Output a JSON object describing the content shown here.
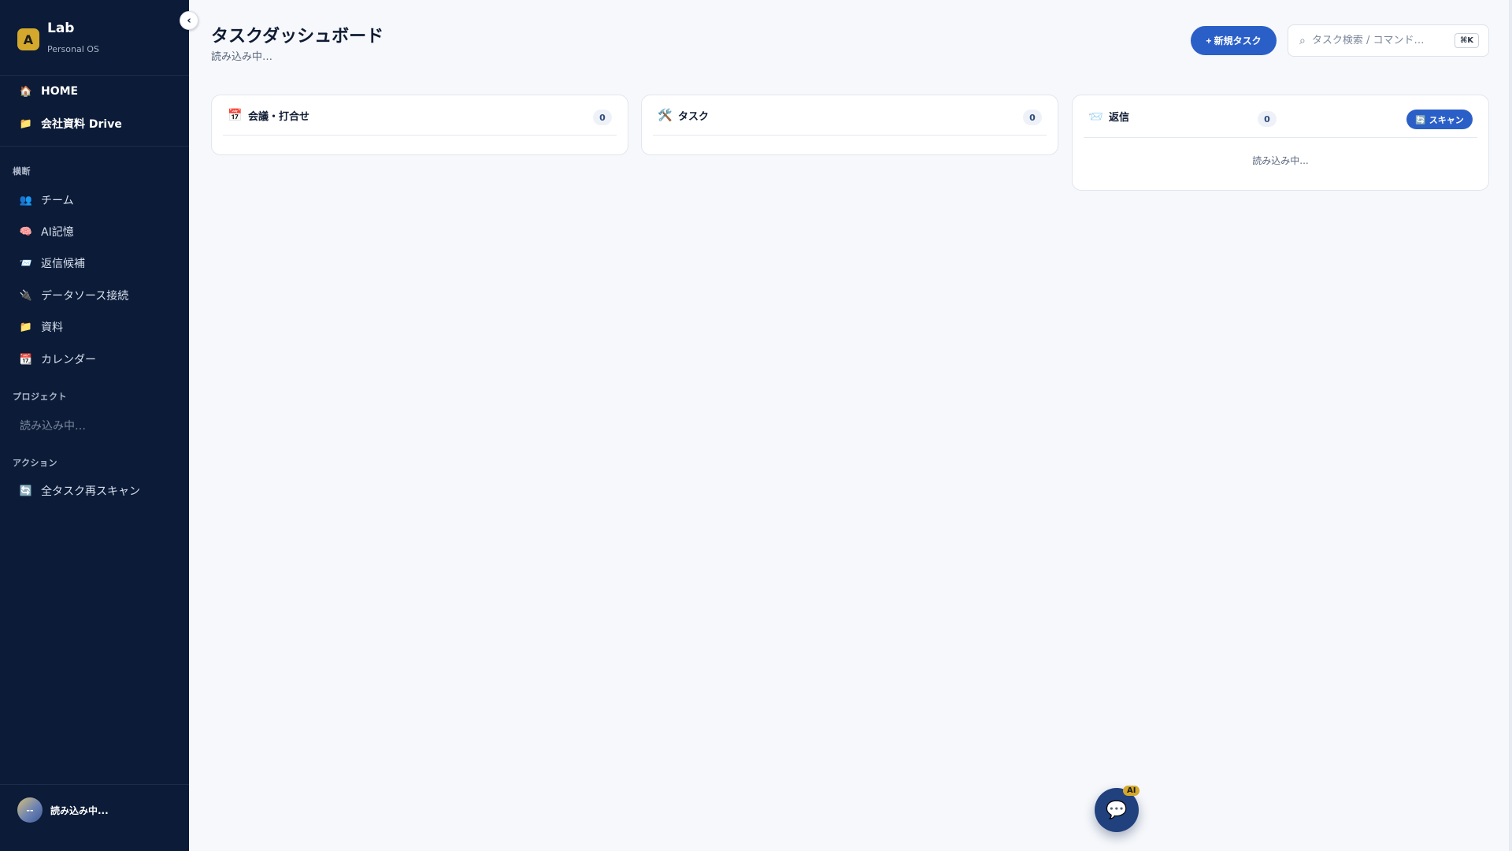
{
  "brand": {
    "logo_letter": "A",
    "name": "Lab",
    "subtitle": "Personal OS"
  },
  "sidebar": {
    "collapse_icon": "‹",
    "primary": [
      {
        "icon": "🏠",
        "label": "HOME"
      },
      {
        "icon": "📁",
        "label": "会社資料 Drive"
      }
    ],
    "section_cross": "横断",
    "cross_items": [
      {
        "icon": "👥",
        "label": "チーム"
      },
      {
        "icon": "🧠",
        "label": "AI記憶"
      },
      {
        "icon": "📨",
        "label": "返信候補"
      },
      {
        "icon": "🔌",
        "label": "データソース接続"
      },
      {
        "icon": "📁",
        "label": "資料"
      },
      {
        "icon": "📆",
        "label": "カレンダー"
      }
    ],
    "section_projects": "プロジェクト",
    "projects_loading": "読み込み中…",
    "section_actions": "アクション",
    "action_items": [
      {
        "icon": "🔄",
        "label": "全タスク再スキャン"
      }
    ],
    "user": {
      "avatar": "--",
      "name": "読み込み中..."
    }
  },
  "header": {
    "title": "タスクダッシュボード",
    "subtitle": "読み込み中…",
    "new_task_label": "+ 新規タスク",
    "search_placeholder": "タスク検索 / コマンド…",
    "search_value": "",
    "shortcut": "⌘K"
  },
  "cards": {
    "meetings": {
      "icon": "📅",
      "title": "会議・打合せ",
      "count": "0"
    },
    "tasks": {
      "icon": "🛠️",
      "title": "タスク",
      "count": "0"
    },
    "replies": {
      "icon": "📨",
      "title": "返信",
      "count": "0",
      "scan_label": "🔄 スキャン",
      "loading": "読み込み中..."
    }
  },
  "fab": {
    "icon": "💬",
    "badge": "AI"
  },
  "colors": {
    "sidebar_bg": "#0b1b38",
    "accent": "#2b5fc8",
    "brand_gold": "#d4a82c",
    "page_bg": "#f6f8fb"
  }
}
